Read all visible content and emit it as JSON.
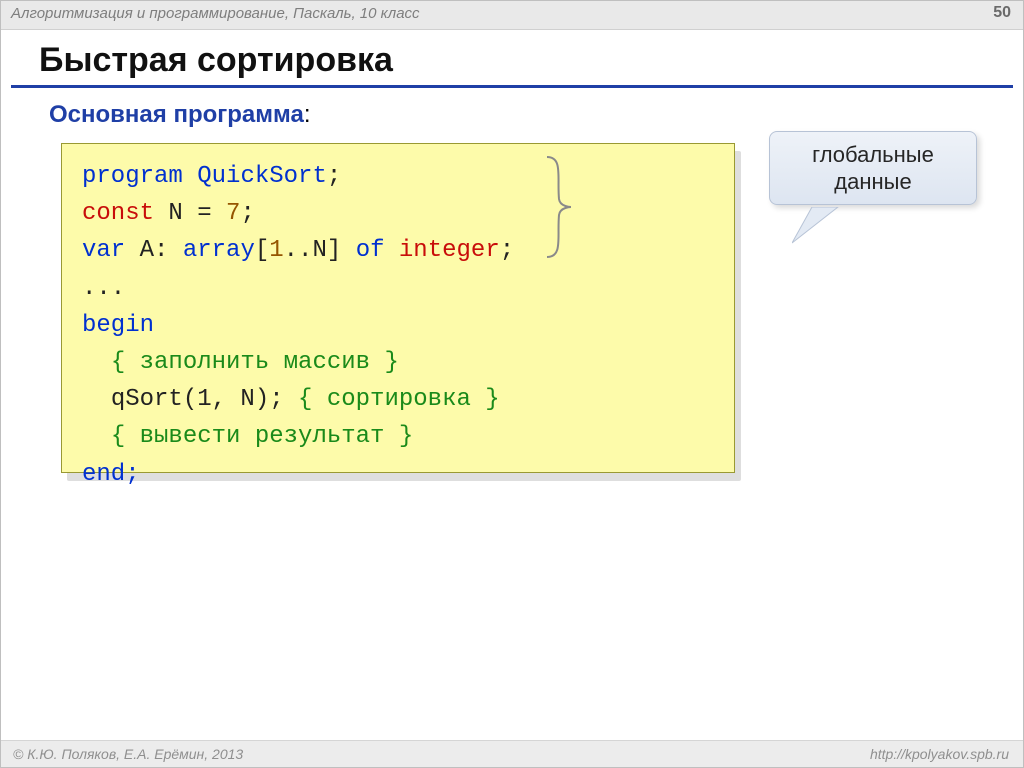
{
  "header": {
    "course_info": "Алгоритмизация и программирование, Паскаль, 10 класс",
    "page_number": "50"
  },
  "title": "Быстрая сортировка",
  "subtitle_text": "Основная программа",
  "subtitle_colon": ":",
  "callout": {
    "line1": "глобальные",
    "line2": "данные"
  },
  "code": {
    "line1": {
      "kw_program": "program",
      "sp1": " ",
      "name": "QuickSort",
      "semi": ";"
    },
    "line2": {
      "kw_const": "const",
      "rest_a": " N",
      "eq": " = ",
      "num": "7",
      "semi": ";"
    },
    "line3": {
      "kw_var": "var",
      "txt_a": " A: ",
      "kw_array": "array",
      "lb": "[",
      "n1": "1",
      "dots": "..",
      "n2": "N",
      "rb": "] ",
      "kw_of": "of",
      "sp2": " ",
      "kw_integer": "integer",
      "semi": ";"
    },
    "line4_dots": "...",
    "line5_begin": "begin",
    "line6_ind": "  ",
    "line6_cmt": "{ заполнить массив }",
    "line7_ind": "  ",
    "line7_call": "qSort(1, N); ",
    "line7_cmt": "{ сортировка }",
    "line8_ind": "  ",
    "line8_cmt": "{ вывести результат }",
    "line9_end": "end;"
  },
  "footer": {
    "left": "© К.Ю. Поляков, Е.А. Ерёмин, 2013",
    "right": "http://kpolyakov.spb.ru"
  }
}
